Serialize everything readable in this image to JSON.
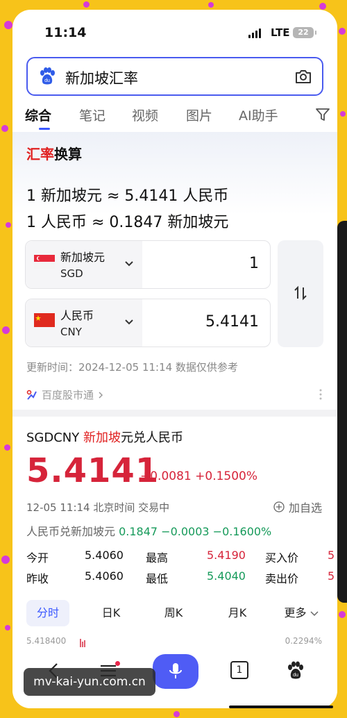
{
  "status_bar": {
    "time": "11:14",
    "network": "LTE",
    "battery": "22"
  },
  "search": {
    "query": "新加坡汇率"
  },
  "tabs": [
    {
      "label": "综合"
    },
    {
      "label": "笔记"
    },
    {
      "label": "视频"
    },
    {
      "label": "图片"
    },
    {
      "label": "AI助手"
    }
  ],
  "converter": {
    "title_accent": "汇率",
    "title_rest": "换算",
    "rate_line_1": "1 新加坡元 ≈ 5.4141 人民币",
    "rate_line_2": "1 人民币 ≈ 0.1847 新加坡元",
    "from": {
      "name": "新加坡元",
      "code": "SGD",
      "value": "1"
    },
    "to": {
      "name": "人民币",
      "code": "CNY",
      "value": "5.4141"
    },
    "updated": "更新时间：2024-12-05 11:14 数据仅供参考",
    "source": "百度股市通"
  },
  "quote": {
    "pair_code": "SGDCNY",
    "pair_accent": "新加坡",
    "pair_rest": "元兑人民币",
    "price": "5.4141",
    "change": "+0.0081 +0.1500%",
    "time": "12-05 11:14 北京时间 交易中",
    "add_watch": "加自选",
    "inverse_label": "人民币兑新加坡元",
    "inverse_values": "0.1847 −0.0003 −0.1600%",
    "rows": [
      {
        "l1": "今开",
        "v1": "5.4060",
        "l2": "最高",
        "v2": "5.4190",
        "l3": "买入价",
        "v3": "5"
      },
      {
        "l1": "昨收",
        "v1": "5.4060",
        "l2": "最低",
        "v2": "5.4040",
        "l3": "卖出价",
        "v3": "5"
      }
    ],
    "chart_tabs": [
      {
        "label": "分时"
      },
      {
        "label": "日K"
      },
      {
        "label": "周K"
      },
      {
        "label": "月K"
      },
      {
        "label": "更多"
      }
    ],
    "chart_top_value": "5.418400",
    "chart_top_pct": "0.2294%"
  },
  "bottom_nav": {
    "tab_count": "1"
  },
  "watermark": "mv-kai-yun.com.cn",
  "colors": {
    "accent": "#4a5bef",
    "up_red": "#d6243a",
    "down_green": "#169a5a",
    "background": "#f7c31a"
  }
}
